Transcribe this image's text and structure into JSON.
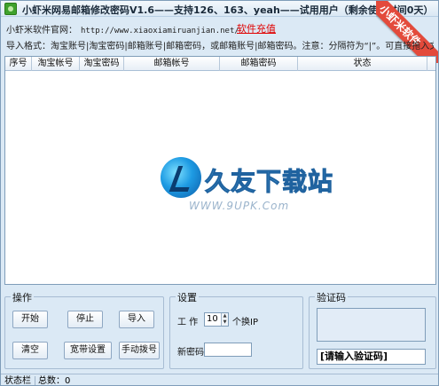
{
  "window": {
    "title": "小虾米网易邮箱修改密码V1.6——支持126、163、yeah——试用用户（剩余使用时间0天）"
  },
  "ribbon": {
    "text": "小虾米软件"
  },
  "site": {
    "label": "小虾米软件官网：",
    "url": "http://www.xiaoxiamiruanjian.net/",
    "recharge": "软件充值"
  },
  "import_hint": "导入格式：淘宝账号|淘宝密码|邮箱账号|邮箱密码，或邮箱账号|邮箱密码。注意：分隔符为“|”。可直接拖入文件",
  "table": {
    "columns": [
      "序号",
      "淘宝帐号",
      "淘宝密码",
      "邮箱帐号",
      "邮箱密码",
      "状态"
    ]
  },
  "watermark": {
    "text": "久友下载站",
    "url": "WWW.9UPK.Com"
  },
  "operations": {
    "title": "操作",
    "start": "开始",
    "stop": "停止",
    "import": "导入",
    "clear": "清空",
    "broadband": "宽带设置",
    "manual_dial": "手动拨号"
  },
  "settings": {
    "title": "设置",
    "work_label": "工 作",
    "work_value": "10",
    "work_suffix": "个换IP",
    "new_password_label": "新密码",
    "new_password_value": ""
  },
  "captcha": {
    "title": "验证码",
    "input_value": "[请输入验证码]"
  },
  "status": {
    "label": "状态栏",
    "total": "总数：0"
  }
}
